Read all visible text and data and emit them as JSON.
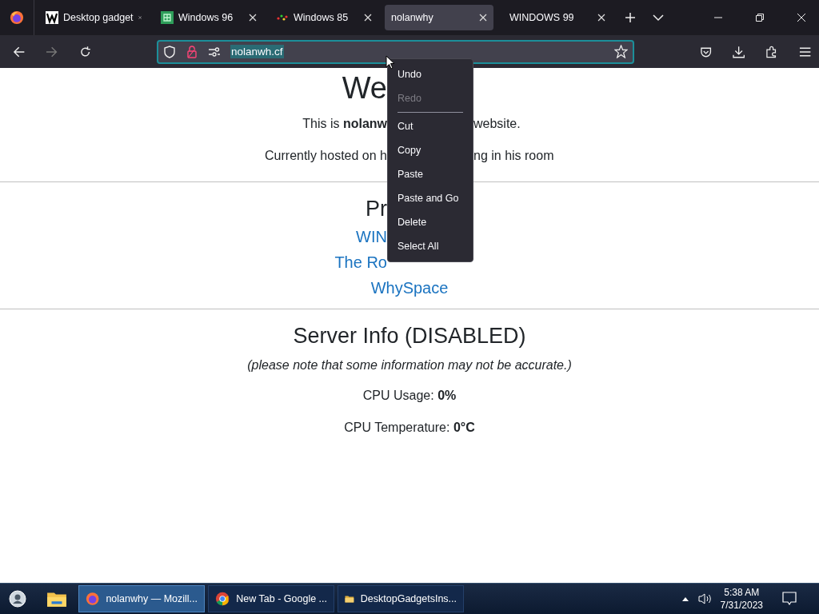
{
  "tabs": [
    {
      "title": "Desktop gadget",
      "selected": false
    },
    {
      "title": "Windows 96",
      "selected": false
    },
    {
      "title": "Windows 85",
      "selected": false
    },
    {
      "title": "nolanwhy",
      "selected": true
    },
    {
      "title": "WINDOWS 99",
      "selected": false
    }
  ],
  "address_bar": {
    "url": "nolanwh.cf",
    "url_selected": true
  },
  "page": {
    "sections": [
      {
        "rows": [
          {
            "kind": "title",
            "left": "We"
          },
          {
            "kind": "text",
            "left": "This is **nolanw**",
            "right": "website."
          },
          {
            "kind": "text",
            "left": "Currently hosted on h",
            "right": "ng in his room"
          }
        ]
      },
      {
        "rows": [
          {
            "kind": "heading",
            "left": "Pr"
          },
          {
            "kind": "link",
            "left": "WIN"
          },
          {
            "kind": "link",
            "left": "The Ro"
          },
          {
            "kind": "link",
            "text": "WhySpace"
          }
        ]
      },
      {
        "rows": [
          {
            "kind": "heading",
            "text": "Server Info (DISABLED)"
          },
          {
            "kind": "note",
            "text": "(please note that some information may not be accurate.)"
          },
          {
            "kind": "text",
            "text": "CPU Usage: **0%**"
          },
          {
            "kind": "text",
            "text": "CPU Temperature: **0°C**"
          }
        ]
      }
    ]
  },
  "context_menu": {
    "items": [
      {
        "kind": "item",
        "label": "Undo",
        "disabled": false
      },
      {
        "kind": "item",
        "label": "Redo",
        "disabled": true
      },
      {
        "kind": "separator"
      },
      {
        "kind": "item",
        "label": "Cut",
        "disabled": false
      },
      {
        "kind": "item",
        "label": "Copy",
        "disabled": false
      },
      {
        "kind": "item",
        "label": "Paste",
        "disabled": false
      },
      {
        "kind": "item",
        "label": "Paste and Go",
        "disabled": false
      },
      {
        "kind": "item",
        "label": "Delete",
        "disabled": false
      },
      {
        "kind": "item",
        "label": "Select All",
        "disabled": false
      }
    ]
  },
  "taskbar": {
    "windows": [
      {
        "label": "nolanwhy — Mozill...",
        "selected": true
      },
      {
        "label": "New Tab - Google ...",
        "selected": false
      },
      {
        "label": "DesktopGadgetsIns...",
        "selected": false
      }
    ],
    "time": "5:38 AM",
    "date": "7/31/2023"
  }
}
